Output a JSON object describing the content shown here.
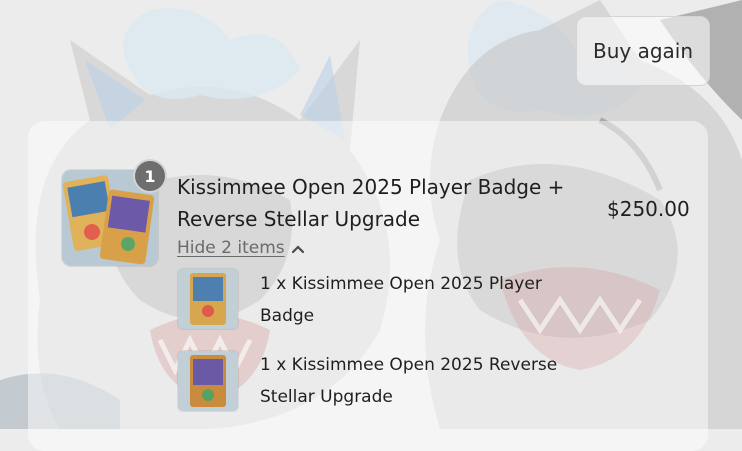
{
  "header": {
    "buy_again_label": "Buy again"
  },
  "order": {
    "quantity_badge": "1",
    "product_title": "Kissimmee Open 2025 Player Badge + Reverse Stellar Upgrade",
    "price": "$250.00",
    "toggle_label": "Hide 2 items",
    "toggle_icon": "chevron-up-icon",
    "items": [
      {
        "label": "1 x Kissimmee Open 2025 Player Badge"
      },
      {
        "label": "1 x Kissimmee Open 2025 Reverse Stellar Upgrade"
      }
    ]
  },
  "colors": {
    "background": "#ececec",
    "badge": "#6e6e6e",
    "text": "#1f1f1f",
    "muted_text": "#6a6a6a"
  }
}
